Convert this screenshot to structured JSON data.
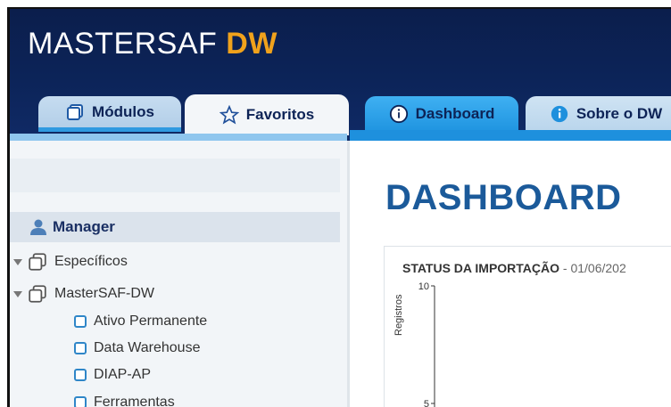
{
  "brand": {
    "name": "MASTERSAF",
    "accent": "DW",
    "accent_color": "#f0a21c"
  },
  "left_tabs": [
    {
      "label": "Módulos",
      "icon": "modules-icon"
    },
    {
      "label": "Favoritos",
      "icon": "star-icon",
      "active": true
    }
  ],
  "right_tabs": [
    {
      "label": "Dashboard",
      "icon": "info-circle-icon",
      "active": true
    },
    {
      "label": "Sobre o DW",
      "icon": "info-icon"
    }
  ],
  "sidebar": {
    "user": "Manager",
    "tree": [
      {
        "label": "Específicos"
      },
      {
        "label": "MasterSAF-DW"
      }
    ],
    "items": [
      {
        "label": "Ativo Permanente"
      },
      {
        "label": "Data Warehouse"
      },
      {
        "label": "DIAP-AP"
      },
      {
        "label": "Ferramentas"
      }
    ]
  },
  "main": {
    "title": "DASHBOARD"
  },
  "chart_data": {
    "type": "bar",
    "title": "STATUS DA IMPORTAÇÃO",
    "title_date": "- 01/06/202",
    "ylabel": "Registros",
    "ylim": [
      0,
      10
    ],
    "yticks": [
      "10",
      "5"
    ],
    "categories": [],
    "values": []
  }
}
